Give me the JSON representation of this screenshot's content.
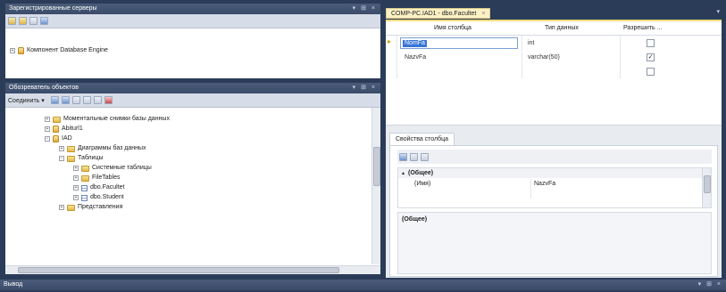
{
  "registered_servers": {
    "title": "Зарегистрированные серверы",
    "window_controls": "▾ ⊞ ×",
    "tree_item": "Компонент Database Engine"
  },
  "object_explorer": {
    "title": "Обозреватель объектов",
    "window_controls": "▾ ⊞ ×",
    "connect_label": "Соединить ▾",
    "tree": [
      {
        "label": "Моментальные снимки базы данных",
        "icon": "folder-icon",
        "expander": "+"
      },
      {
        "label": "Abiturl1",
        "icon": "database-icon",
        "expander": "+"
      },
      {
        "label": "IAD",
        "icon": "database-icon",
        "expander": "−"
      },
      {
        "label": "Диаграммы баз данных",
        "icon": "folder-icon",
        "expander": "+"
      },
      {
        "label": "Таблицы",
        "icon": "folder-icon",
        "expander": "−"
      },
      {
        "label": "Системные таблицы",
        "icon": "folder-icon",
        "expander": "+"
      },
      {
        "label": "FileTables",
        "icon": "folder-icon",
        "expander": "+"
      },
      {
        "label": "dbo.Facultet",
        "icon": "table-icon",
        "expander": "+"
      },
      {
        "label": "dbo.Student",
        "icon": "table-icon",
        "expander": "+"
      },
      {
        "label": "Представления",
        "icon": "folder-icon",
        "expander": "+"
      }
    ]
  },
  "designer": {
    "tab_label": "COMP-PC.IAD1 - dbo.Facultet",
    "tab_close": "×",
    "pane_pin": "▾",
    "columns": {
      "name": "Имя столбца",
      "type": "Тип данных",
      "nullable": "Разрешить ..."
    },
    "rows": [
      {
        "marker": "▸",
        "name": "NomFa",
        "type": "int",
        "nullable": false,
        "selected": true
      },
      {
        "marker": "",
        "name": "NazvFa",
        "type": "varchar(50)",
        "nullable": true,
        "selected": false
      },
      {
        "marker": "",
        "name": "",
        "type": "",
        "nullable": false,
        "selected": false
      }
    ]
  },
  "column_properties": {
    "tab_label": "Свойства столбца",
    "group_label": "(Общее)",
    "group_expander": "▴",
    "property_name": "(Имя)",
    "property_value": "NazvFa",
    "description": "(Общее)"
  },
  "output": {
    "title": "Вывод",
    "window_controls": "▾ ⊞ ×"
  }
}
